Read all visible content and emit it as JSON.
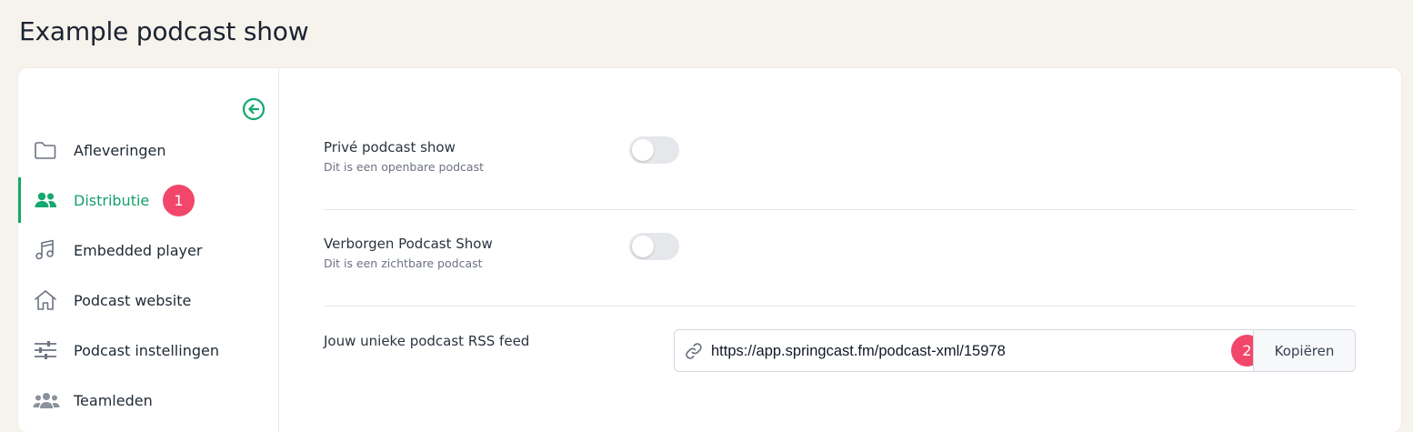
{
  "page": {
    "title": "Example podcast show"
  },
  "sidebar": {
    "collapse_icon": "arrow-left-circle-icon",
    "items": [
      {
        "label": "Afleveringen",
        "icon": "folder-icon",
        "active": false
      },
      {
        "label": "Distributie",
        "icon": "users-icon",
        "active": true,
        "badge": "1"
      },
      {
        "label": "Embedded player",
        "icon": "music-note-icon",
        "active": false
      },
      {
        "label": "Podcast website",
        "icon": "home-icon",
        "active": false
      },
      {
        "label": "Podcast instellingen",
        "icon": "sliders-icon",
        "active": false
      },
      {
        "label": "Teamleden",
        "icon": "team-icon",
        "active": false
      }
    ]
  },
  "settings": {
    "private": {
      "title": "Privé podcast show",
      "description": "Dit is een openbare podcast",
      "enabled": false
    },
    "hidden": {
      "title": "Verborgen Podcast Show",
      "description": "Dit is een zichtbare podcast",
      "enabled": false
    },
    "rss": {
      "label": "Jouw unieke podcast RSS feed",
      "url": "https://app.springcast.fm/podcast-xml/15978",
      "copy_label": "Kopiëren",
      "badge": "2",
      "link_icon": "link-icon"
    }
  },
  "colors": {
    "accent": "#15a870",
    "badge": "#f2476a",
    "background": "#f6f3ec"
  }
}
